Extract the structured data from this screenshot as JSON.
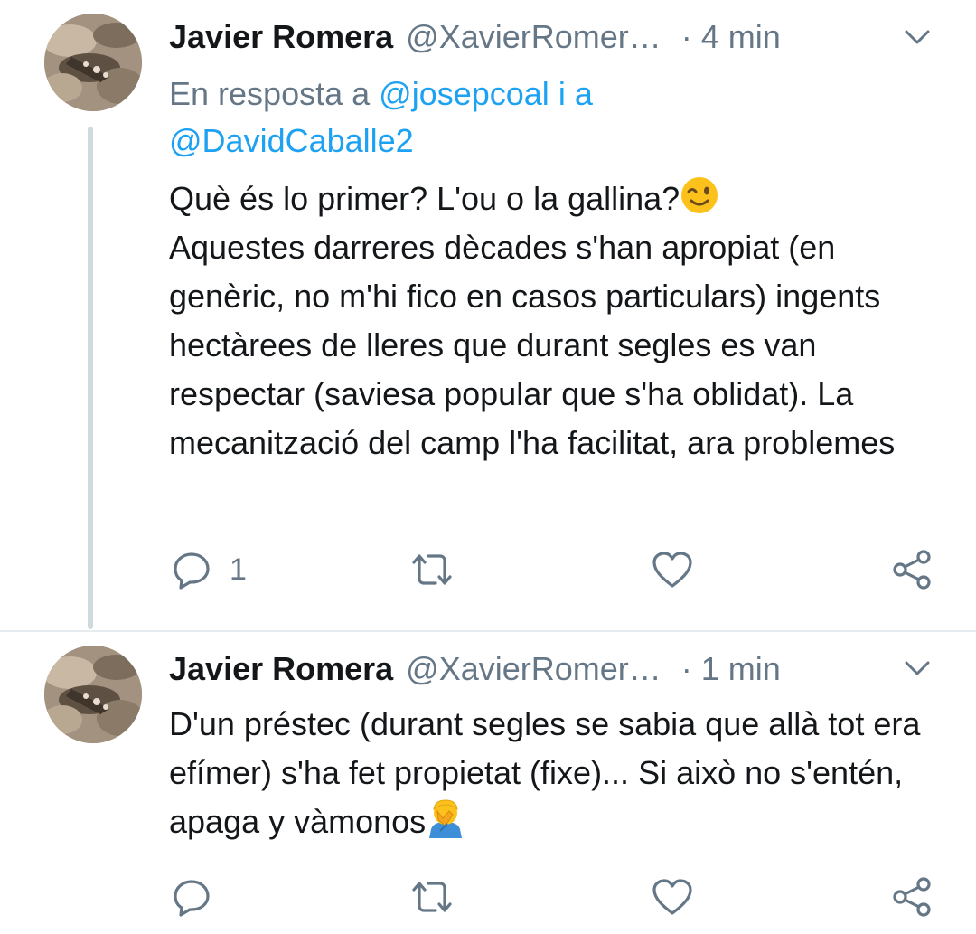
{
  "tweets": [
    {
      "name": "Javier Romera",
      "handle": "@XavierRomer…",
      "separator": "·",
      "time": "4 min",
      "reply_prefix": "En resposta a",
      "reply_to_1": "@josepcoal",
      "reply_join": "i a",
      "reply_to_2": "@DavidCaballe2",
      "text_a": "Què és lo primer? L'ou o la gallina?",
      "emoji_a": "winking-face",
      "text_b": "Aquestes darreres dècades s'han apropiat (en genèric, no m'hi fico en casos particulars) ingents hectàrees de lleres que durant segles es van respectar (saviesa popular que s'ha oblidat). La mecanització del camp l'ha facilitat, ara problemes",
      "reply_count": "1"
    },
    {
      "name": "Javier Romera",
      "handle": "@XavierRomer…",
      "separator": "·",
      "time": "1 min",
      "text_a": "D'un préstec (durant segles se sabia que allà tot era efímer) s'ha fet propietat (fixe)... Si això no s'entén, apaga y vàmonos",
      "emoji_a": "person-facepalming",
      "reply_count": ""
    }
  ],
  "colors": {
    "text": "#14171a",
    "secondary": "#657786",
    "link": "#1da1f2",
    "thread_line": "#cfd9de"
  }
}
